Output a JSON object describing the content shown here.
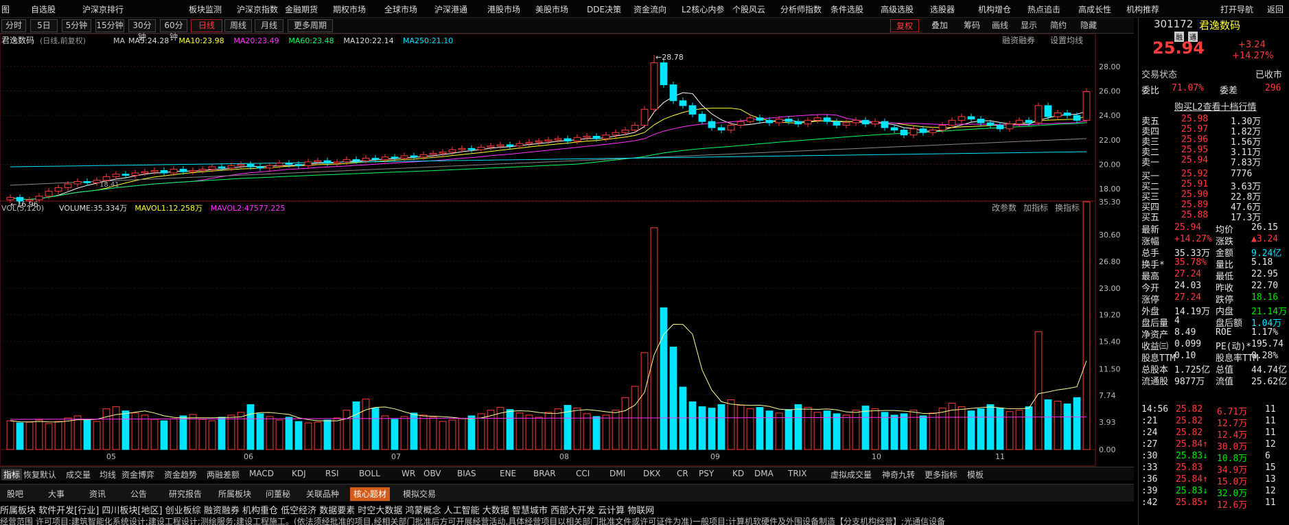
{
  "top_menu": [
    "图",
    "自选股",
    "沪深京排行",
    "板块监测",
    "沪深京指数",
    "金融期货",
    "期权市场",
    "全球市场",
    "沪深港通",
    "港股市场",
    "美股市场",
    "DDE决策",
    "资金流向",
    "L2核心内参",
    "个股风云",
    "分析师指数",
    "条件选股",
    "高级选股",
    "选股器",
    "机构增仓",
    "热点追击",
    "高成长性",
    "机构推荐",
    "打开导航",
    "返回"
  ],
  "periods": [
    "分时",
    "5日",
    "5分钟",
    "15分钟",
    "30分钟",
    "60分钟",
    "日线",
    "周线",
    "月线",
    "更多周期"
  ],
  "toolbar": [
    "复权",
    "叠加",
    "筹码",
    "画线",
    "显示",
    "简约",
    "隐藏"
  ],
  "chart_header": {
    "name": "君逸数码",
    "mode": "(日线,前复权)",
    "ma_items": [
      "MA",
      "MA5:24.28",
      "MA10:23.98",
      "MA20:23.49",
      "MA60:23.48",
      "MA120:22.14",
      "MA250:21.10"
    ],
    "right": [
      "融资融券",
      "设置均线"
    ]
  },
  "vol_header": {
    "items": [
      "VOL(5,120)",
      "VOLUME:35.334万",
      "MAVOL1:12.258万",
      "MAVOL2:47577.225"
    ],
    "right": [
      "改参数",
      "加指标",
      "换指标"
    ]
  },
  "annotations": {
    "high": "28.78",
    "low": "16.96",
    "mid": "18.41"
  },
  "price_axis": [
    "28.00",
    "26.00",
    "24.00",
    "22.00",
    "20.00",
    "18.00"
  ],
  "vol_axis": [
    "35.30",
    "30.60",
    "26.80",
    "23.00",
    "19.20",
    "15.40",
    "11.50",
    "7.74",
    "3.93",
    "0.00"
  ],
  "x_labels": [
    "05",
    "06",
    "07",
    "08",
    "09",
    "10",
    "11"
  ],
  "indicator_tabs": [
    "指标",
    "恢复默认",
    "成交量",
    "均线",
    "资金博弈",
    "资金趋势",
    "两融差额",
    "MACD",
    "KDJ",
    "RSI",
    "BOLL",
    "WR",
    "OBV",
    "BIAS",
    "ENE",
    "BRAR",
    "CCI",
    "DMI",
    "DKX",
    "CR",
    "PSY",
    "KD",
    "DMA",
    "TRIX",
    "虚拟成交量",
    "神奇九转",
    "更多指标",
    "模板"
  ],
  "info_tabs": [
    "股吧",
    "大事",
    "资讯",
    "公告",
    "研究报告",
    "所属板块",
    "问董秘",
    "关联品种",
    "核心题材",
    "模拟交易"
  ],
  "concepts": "所属板块  软件开发[行业] 四川板块[地区] 创业板综 融资融券 机构重仓 低空经济 数据要素 时空大数据 鸿蒙概念 人工智能 大数据 智慧城市 西部大开发 云计算 物联网",
  "description": "经营范围  许可项目:建筑智能化系统设计;建设工程设计;测绘服务;建设工程施工。(依法须经批准的项目,经相关部门批准后方可开展经营活动,具体经营项目以相关部门批准文件或许可证件为准)一般项目:计算机软硬件及外围设备制造【分支机构经营】;光通信设备",
  "quote": {
    "code": "301172",
    "name": "君逸数码",
    "tags": [
      "融",
      "通"
    ],
    "price": "25.94",
    "change": "+3.24",
    "pct": "+14.27%",
    "status_label": "交易状态",
    "status": "已收市",
    "webi": [
      "委比",
      "71.07%",
      "委差",
      "296"
    ],
    "l2": "购买L2查看十档行情",
    "asks": [
      [
        "卖五",
        "25.98",
        "1.30万"
      ],
      [
        "卖四",
        "25.97",
        "1.82万"
      ],
      [
        "卖三",
        "25.96",
        "1.56万"
      ],
      [
        "卖二",
        "25.95",
        "3.11万"
      ],
      [
        "卖一",
        "25.94",
        "7.83万"
      ]
    ],
    "bids": [
      [
        "买一",
        "25.92",
        "7776"
      ],
      [
        "买二",
        "25.91",
        "3.63万"
      ],
      [
        "买三",
        "25.90",
        "22.8万"
      ],
      [
        "买四",
        "25.89",
        "47.6万"
      ],
      [
        "买五",
        "25.88",
        "17.3万"
      ]
    ],
    "stats": [
      [
        "最新",
        "25.94",
        "均价",
        "26.15"
      ],
      [
        "涨幅",
        "+14.27%",
        "涨跌",
        "▲3.24"
      ],
      [
        "总手",
        "35.33万",
        "金额",
        "9.24亿"
      ],
      [
        "换手*",
        "35.78%",
        "量比",
        "5.18"
      ],
      [
        "最高",
        "27.24",
        "最低",
        "22.95"
      ],
      [
        "今开",
        "24.03",
        "昨收",
        "22.70"
      ],
      [
        "涨停",
        "27.24",
        "跌停",
        "18.16"
      ],
      [
        "外盘",
        "14.19万",
        "内盘",
        "21.14万"
      ],
      [
        "盘后量",
        "4",
        "盘后额",
        "1.04万"
      ],
      [
        "净资产",
        "8.49",
        "ROE",
        "1.17%"
      ],
      [
        "收益㈢",
        "0.099",
        "PE(动)*",
        "195.74"
      ],
      [
        "股息TTM",
        "0.10",
        "股息率TTM",
        "0.28%"
      ],
      [
        "总股本",
        "1.725亿",
        "总值",
        "44.74亿"
      ],
      [
        "流通股",
        "9877万",
        "流值",
        "25.62亿"
      ]
    ],
    "ticks": [
      [
        "14:56",
        "25.82",
        "6.71万",
        "11"
      ],
      [
        ":21",
        "25.82",
        "12.7万",
        "11"
      ],
      [
        ":24",
        "25.82",
        "12.4万",
        "11"
      ],
      [
        ":27",
        "25.84↑",
        "30.0万",
        "12"
      ],
      [
        ":30",
        "25.83↓",
        "10.8万",
        "6"
      ],
      [
        ":33",
        "25.83",
        "34.9万",
        "15"
      ],
      [
        ":36",
        "25.84↑",
        "15.0万",
        "13"
      ],
      [
        ":39",
        "25.83↓",
        "32.0万",
        "12"
      ],
      [
        ":42",
        "25.85↑",
        "12.6万",
        "11"
      ]
    ]
  },
  "chart_data": {
    "type": "candlestick",
    "xlabels": [
      "05",
      "06",
      "07",
      "08",
      "09",
      "10",
      "11"
    ],
    "ylim": [
      17,
      29
    ],
    "vol_ylim": [
      0,
      35.3
    ],
    "close": [
      17.3,
      17.0,
      17.1,
      17.4,
      17.8,
      18.1,
      18.4,
      18.6,
      18.5,
      18.7,
      19.0,
      19.2,
      19.1,
      19.3,
      19.4,
      19.5,
      19.3,
      19.6,
      19.4,
      19.5,
      19.6,
      19.8,
      19.7,
      19.9,
      20.0,
      19.8,
      19.7,
      19.9,
      20.1,
      20.0,
      19.9,
      20.2,
      20.3,
      20.1,
      20.2,
      20.4,
      20.3,
      20.5,
      20.4,
      20.6,
      20.5,
      20.7,
      20.6,
      20.8,
      20.9,
      21.0,
      21.2,
      21.3,
      21.2,
      21.4,
      21.5,
      21.6,
      21.5,
      21.7,
      21.8,
      21.9,
      22.0,
      22.1,
      21.9,
      22.2,
      22.3,
      22.1,
      22.4,
      22.6,
      22.8,
      23.2,
      24.5,
      28.3,
      26.5,
      25.2,
      24.8,
      24.1,
      23.5,
      23.0,
      22.8,
      23.2,
      23.5,
      23.8,
      23.6,
      23.4,
      23.7,
      23.5,
      23.3,
      23.6,
      23.8,
      23.5,
      23.2,
      23.4,
      23.6,
      23.3,
      23.5,
      23.0,
      22.8,
      22.4,
      22.9,
      22.6,
      22.8,
      23.2,
      23.6,
      23.9,
      23.7,
      23.4,
      23.2,
      22.9,
      23.3,
      23.6,
      23.4,
      24.8,
      23.9,
      24.2,
      24.0,
      23.6,
      25.94
    ],
    "volume": [
      4.1,
      3.8,
      3.9,
      4.2,
      3.7,
      4.0,
      4.5,
      4.8,
      4.2,
      4.0,
      5.8,
      6.1,
      5.5,
      5.2,
      4.9,
      4.3,
      4.1,
      4.4,
      4.8,
      5.0,
      4.3,
      4.1,
      4.6,
      4.9,
      5.3,
      6.4,
      5.1,
      4.7,
      4.2,
      4.6,
      4.0,
      3.8,
      3.9,
      4.2,
      4.5,
      5.6,
      6.8,
      7.2,
      5.9,
      4.8,
      4.3,
      4.7,
      5.2,
      4.9,
      4.6,
      4.0,
      4.2,
      4.4,
      4.8,
      5.1,
      5.6,
      6.0,
      5.7,
      5.2,
      4.9,
      4.6,
      5.3,
      5.8,
      6.3,
      5.9,
      5.1,
      4.7,
      4.9,
      5.6,
      7.4,
      9.0,
      13.8,
      31.6,
      20.2,
      14.6,
      8.9,
      6.8,
      6.1,
      5.9,
      6.4,
      7.1,
      6.3,
      5.8,
      6.0,
      5.5,
      5.2,
      5.7,
      6.4,
      6.0,
      5.3,
      5.5,
      5.1,
      4.9,
      5.6,
      6.2,
      5.8,
      5.3,
      4.9,
      5.1,
      5.6,
      4.8,
      5.2,
      5.9,
      6.6,
      6.1,
      5.5,
      5.8,
      6.4,
      5.9,
      5.4,
      5.6,
      6.1,
      16.8,
      7.1,
      6.9,
      6.5,
      7.4,
      35.3
    ]
  }
}
